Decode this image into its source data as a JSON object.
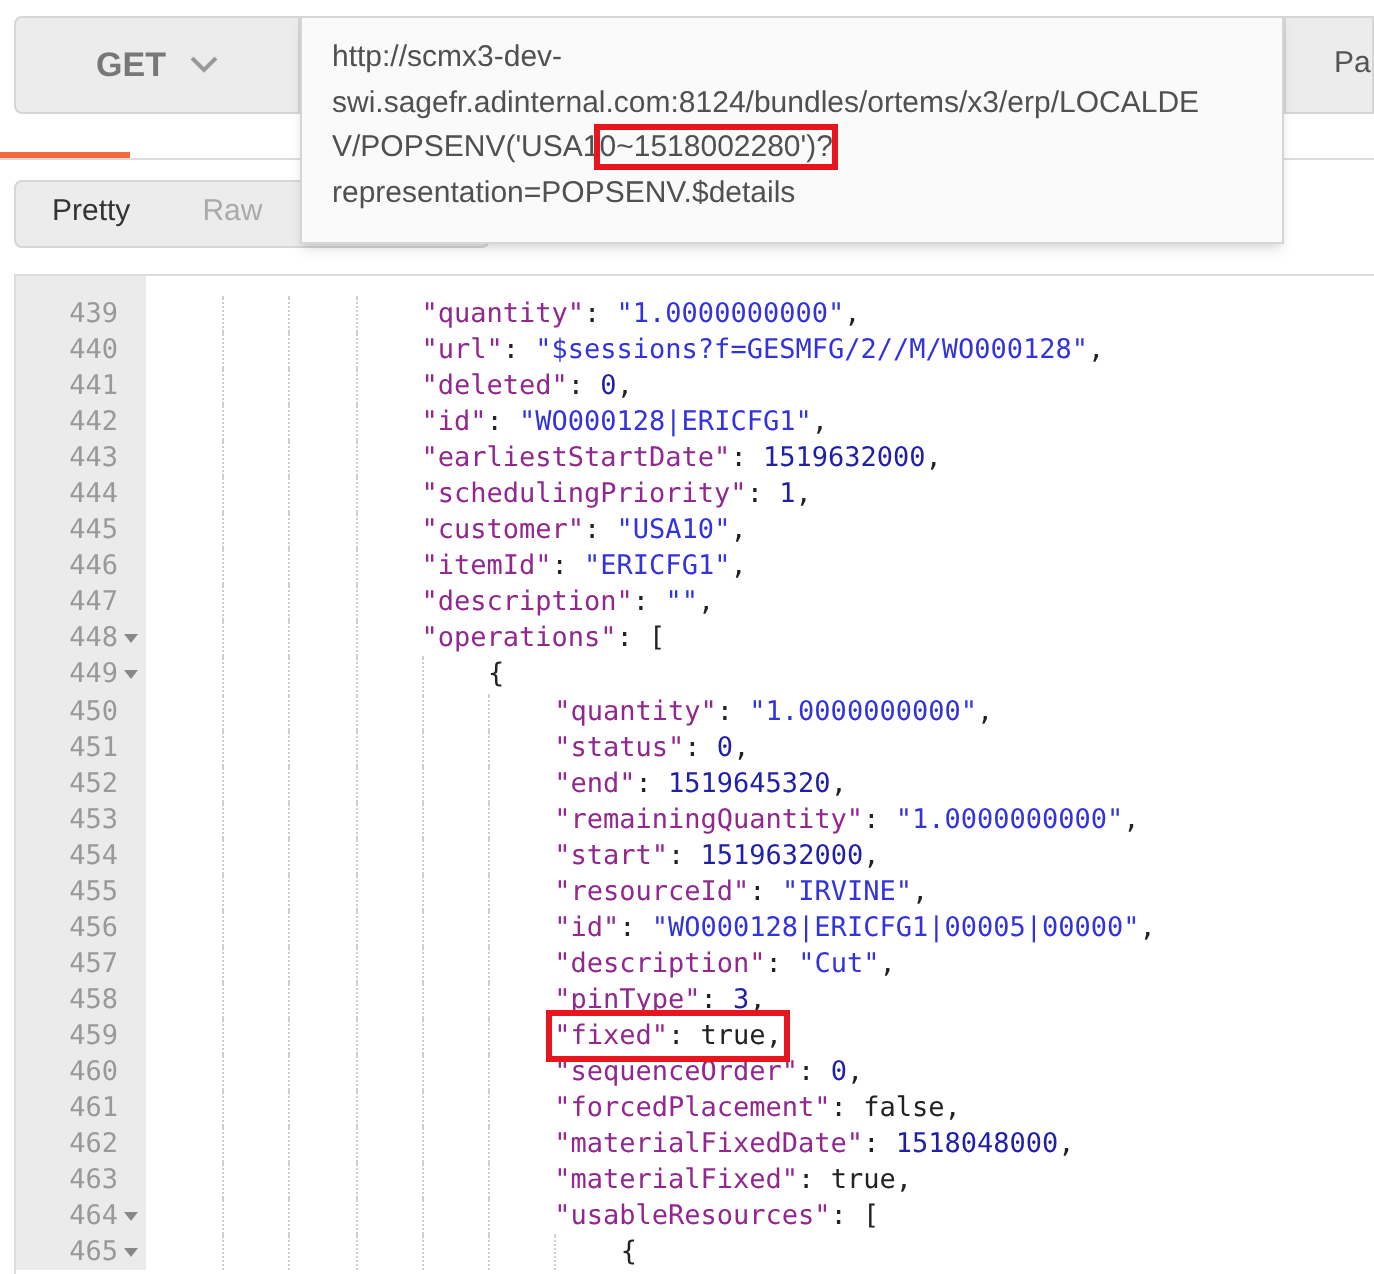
{
  "request": {
    "method": "GET",
    "params_button": "Pa",
    "url_lines": [
      [
        {
          "text": "http://scmx3-dev-",
          "highlighted": false
        }
      ],
      [
        {
          "text": "swi.sagefr.adinternal.com:8124/bundles/ortems/x3/erp/LOCALDE",
          "highlighted": false
        }
      ],
      [
        {
          "text": "V/POPSENV('USA1",
          "highlighted": false
        },
        {
          "text": "0~1518002280')?",
          "highlighted": true
        }
      ],
      [
        {
          "text": "representation=POPSENV.$details",
          "highlighted": false
        }
      ]
    ]
  },
  "view_modes": [
    {
      "label": "Pretty",
      "selected": true
    },
    {
      "label": "Raw",
      "selected": false
    }
  ],
  "code_lines": [
    {
      "number": "439",
      "fold": false,
      "highlighted": false,
      "parts": [
        {
          "kind": "key",
          "text": "\"quantity\""
        },
        {
          "kind": "punct",
          "text": ": "
        },
        {
          "kind": "string",
          "text": "\"1.0000000000\""
        },
        {
          "kind": "punct",
          "text": ","
        }
      ]
    },
    {
      "number": "440",
      "fold": false,
      "highlighted": false,
      "parts": [
        {
          "kind": "key",
          "text": "\"url\""
        },
        {
          "kind": "punct",
          "text": ": "
        },
        {
          "kind": "string",
          "text": "\"$sessions?f=GESMFG/2//M/WO000128\""
        },
        {
          "kind": "punct",
          "text": ","
        }
      ]
    },
    {
      "number": "441",
      "fold": false,
      "highlighted": false,
      "parts": [
        {
          "kind": "key",
          "text": "\"deleted\""
        },
        {
          "kind": "punct",
          "text": ": "
        },
        {
          "kind": "number",
          "text": "0"
        },
        {
          "kind": "punct",
          "text": ","
        }
      ]
    },
    {
      "number": "442",
      "fold": false,
      "highlighted": false,
      "parts": [
        {
          "kind": "key",
          "text": "\"id\""
        },
        {
          "kind": "punct",
          "text": ": "
        },
        {
          "kind": "string",
          "text": "\"WO000128|ERICFG1\""
        },
        {
          "kind": "punct",
          "text": ","
        }
      ]
    },
    {
      "number": "443",
      "fold": false,
      "highlighted": false,
      "parts": [
        {
          "kind": "key",
          "text": "\"earliestStartDate\""
        },
        {
          "kind": "punct",
          "text": ": "
        },
        {
          "kind": "number",
          "text": "1519632000"
        },
        {
          "kind": "punct",
          "text": ","
        }
      ]
    },
    {
      "number": "444",
      "fold": false,
      "highlighted": false,
      "parts": [
        {
          "kind": "key",
          "text": "\"schedulingPriority\""
        },
        {
          "kind": "punct",
          "text": ": "
        },
        {
          "kind": "number",
          "text": "1"
        },
        {
          "kind": "punct",
          "text": ","
        }
      ]
    },
    {
      "number": "445",
      "fold": false,
      "highlighted": false,
      "parts": [
        {
          "kind": "key",
          "text": "\"customer\""
        },
        {
          "kind": "punct",
          "text": ": "
        },
        {
          "kind": "string",
          "text": "\"USA10\""
        },
        {
          "kind": "punct",
          "text": ","
        }
      ]
    },
    {
      "number": "446",
      "fold": false,
      "highlighted": false,
      "parts": [
        {
          "kind": "key",
          "text": "\"itemId\""
        },
        {
          "kind": "punct",
          "text": ": "
        },
        {
          "kind": "string",
          "text": "\"ERICFG1\""
        },
        {
          "kind": "punct",
          "text": ","
        }
      ]
    },
    {
      "number": "447",
      "fold": false,
      "highlighted": false,
      "parts": [
        {
          "kind": "key",
          "text": "\"description\""
        },
        {
          "kind": "punct",
          "text": ": "
        },
        {
          "kind": "string",
          "text": "\"\""
        },
        {
          "kind": "punct",
          "text": ","
        }
      ]
    },
    {
      "number": "448",
      "fold": true,
      "highlighted": false,
      "parts": [
        {
          "kind": "key",
          "text": "\"operations\""
        },
        {
          "kind": "punct",
          "text": ": ["
        }
      ],
      "children": [
        {
          "number": "449",
          "fold": true,
          "highlighted": false,
          "parts": [
            {
              "kind": "punct",
              "text": "{"
            }
          ],
          "children": [
            {
              "number": "450",
              "fold": false,
              "highlighted": false,
              "parts": [
                {
                  "kind": "key",
                  "text": "\"quantity\""
                },
                {
                  "kind": "punct",
                  "text": ": "
                },
                {
                  "kind": "string",
                  "text": "\"1.0000000000\""
                },
                {
                  "kind": "punct",
                  "text": ","
                }
              ]
            },
            {
              "number": "451",
              "fold": false,
              "highlighted": false,
              "parts": [
                {
                  "kind": "key",
                  "text": "\"status\""
                },
                {
                  "kind": "punct",
                  "text": ": "
                },
                {
                  "kind": "number",
                  "text": "0"
                },
                {
                  "kind": "punct",
                  "text": ","
                }
              ]
            },
            {
              "number": "452",
              "fold": false,
              "highlighted": false,
              "parts": [
                {
                  "kind": "key",
                  "text": "\"end\""
                },
                {
                  "kind": "punct",
                  "text": ": "
                },
                {
                  "kind": "number",
                  "text": "1519645320"
                },
                {
                  "kind": "punct",
                  "text": ","
                }
              ]
            },
            {
              "number": "453",
              "fold": false,
              "highlighted": false,
              "parts": [
                {
                  "kind": "key",
                  "text": "\"remainingQuantity\""
                },
                {
                  "kind": "punct",
                  "text": ": "
                },
                {
                  "kind": "string",
                  "text": "\"1.0000000000\""
                },
                {
                  "kind": "punct",
                  "text": ","
                }
              ]
            },
            {
              "number": "454",
              "fold": false,
              "highlighted": false,
              "parts": [
                {
                  "kind": "key",
                  "text": "\"start\""
                },
                {
                  "kind": "punct",
                  "text": ": "
                },
                {
                  "kind": "number",
                  "text": "1519632000"
                },
                {
                  "kind": "punct",
                  "text": ","
                }
              ]
            },
            {
              "number": "455",
              "fold": false,
              "highlighted": false,
              "parts": [
                {
                  "kind": "key",
                  "text": "\"resourceId\""
                },
                {
                  "kind": "punct",
                  "text": ": "
                },
                {
                  "kind": "string",
                  "text": "\"IRVINE\""
                },
                {
                  "kind": "punct",
                  "text": ","
                }
              ]
            },
            {
              "number": "456",
              "fold": false,
              "highlighted": false,
              "parts": [
                {
                  "kind": "key",
                  "text": "\"id\""
                },
                {
                  "kind": "punct",
                  "text": ": "
                },
                {
                  "kind": "string",
                  "text": "\"WO000128|ERICFG1|00005|00000\""
                },
                {
                  "kind": "punct",
                  "text": ","
                }
              ]
            },
            {
              "number": "457",
              "fold": false,
              "highlighted": false,
              "parts": [
                {
                  "kind": "key",
                  "text": "\"description\""
                },
                {
                  "kind": "punct",
                  "text": ": "
                },
                {
                  "kind": "string",
                  "text": "\"Cut\""
                },
                {
                  "kind": "punct",
                  "text": ","
                }
              ]
            },
            {
              "number": "458",
              "fold": false,
              "highlighted": false,
              "parts": [
                {
                  "kind": "key",
                  "text": "\"pinType\""
                },
                {
                  "kind": "punct",
                  "text": ": "
                },
                {
                  "kind": "number",
                  "text": "3"
                },
                {
                  "kind": "punct",
                  "text": ","
                }
              ]
            },
            {
              "number": "459",
              "fold": false,
              "highlighted": true,
              "parts": [
                {
                  "kind": "key",
                  "text": "\"fixed\""
                },
                {
                  "kind": "punct",
                  "text": ": "
                },
                {
                  "kind": "bool",
                  "text": "true"
                },
                {
                  "kind": "punct",
                  "text": ","
                }
              ]
            },
            {
              "number": "460",
              "fold": false,
              "highlighted": false,
              "parts": [
                {
                  "kind": "key",
                  "text": "\"sequenceOrder\""
                },
                {
                  "kind": "punct",
                  "text": ": "
                },
                {
                  "kind": "number",
                  "text": "0"
                },
                {
                  "kind": "punct",
                  "text": ","
                }
              ]
            },
            {
              "number": "461",
              "fold": false,
              "highlighted": false,
              "parts": [
                {
                  "kind": "key",
                  "text": "\"forcedPlacement\""
                },
                {
                  "kind": "punct",
                  "text": ": "
                },
                {
                  "kind": "bool",
                  "text": "false"
                },
                {
                  "kind": "punct",
                  "text": ","
                }
              ]
            },
            {
              "number": "462",
              "fold": false,
              "highlighted": false,
              "parts": [
                {
                  "kind": "key",
                  "text": "\"materialFixedDate\""
                },
                {
                  "kind": "punct",
                  "text": ": "
                },
                {
                  "kind": "number",
                  "text": "1518048000"
                },
                {
                  "kind": "punct",
                  "text": ","
                }
              ]
            },
            {
              "number": "463",
              "fold": false,
              "highlighted": false,
              "parts": [
                {
                  "kind": "key",
                  "text": "\"materialFixed\""
                },
                {
                  "kind": "punct",
                  "text": ": "
                },
                {
                  "kind": "bool",
                  "text": "true"
                },
                {
                  "kind": "punct",
                  "text": ","
                }
              ]
            },
            {
              "number": "464",
              "fold": true,
              "highlighted": false,
              "parts": [
                {
                  "kind": "key",
                  "text": "\"usableResources\""
                },
                {
                  "kind": "punct",
                  "text": ": ["
                }
              ],
              "children": [
                {
                  "number": "465",
                  "fold": true,
                  "highlighted": false,
                  "parts": [
                    {
                      "kind": "punct",
                      "text": "{"
                    }
                  ]
                }
              ]
            }
          ]
        }
      ]
    }
  ]
}
